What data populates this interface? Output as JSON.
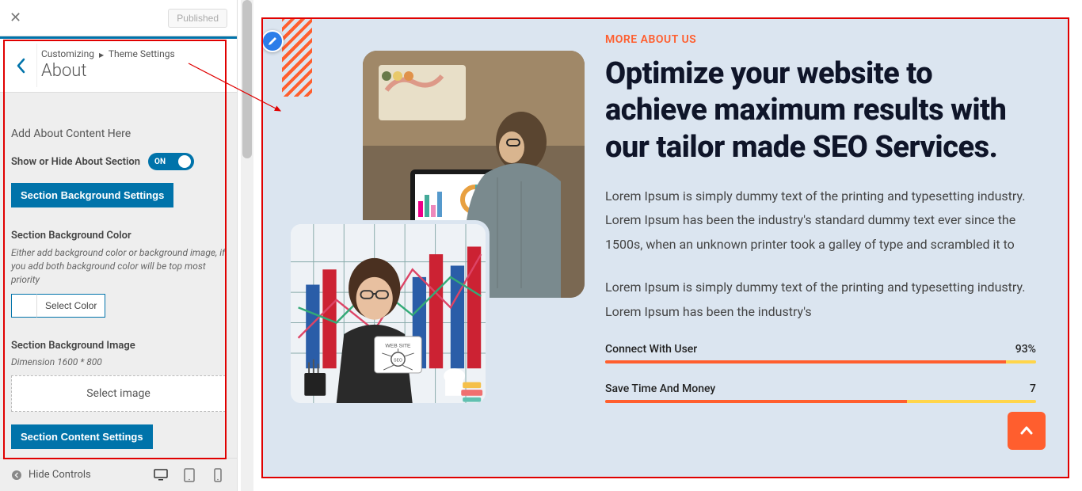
{
  "topbar": {
    "close_symbol": "✕",
    "published_label": "Published"
  },
  "breadcrumb": {
    "customizing": "Customizing",
    "theme_settings": "Theme Settings",
    "section_title": "About"
  },
  "panel": {
    "heading": "Add About Content Here",
    "toggle_label": "Show or Hide About Section",
    "toggle_state": "ON",
    "btn_bg_settings": "Section Background Settings",
    "bg_color_label": "Section Background Color",
    "bg_color_help": "Either add background color or background image, if you add both background color will be top most priority",
    "select_color": "Select Color",
    "bg_image_label": "Section Background Image",
    "bg_image_dim": "Dimension 1600 * 800",
    "select_image": "Select image",
    "btn_content_settings": "Section Content Settings"
  },
  "bottom": {
    "hide_controls": "Hide Controls"
  },
  "preview": {
    "eyebrow": "MORE ABOUT US",
    "headline": "Optimize your website to achieve maximum results with our tailor made SEO Services.",
    "para1": "Lorem Ipsum is simply dummy text of the printing and typesetting industry. Lorem Ipsum has been the industry's standard dummy text ever since the 1500s, when an unknown printer took a galley of type and scrambled it to",
    "para2": "Lorem Ipsum is simply dummy text of the printing and typesetting industry. Lorem Ipsum has been the industry's",
    "progress": [
      {
        "label": "Connect With User",
        "value": "93%",
        "pct": 93
      },
      {
        "label": "Save Time And Money",
        "value": "7",
        "pct": 70
      }
    ]
  }
}
